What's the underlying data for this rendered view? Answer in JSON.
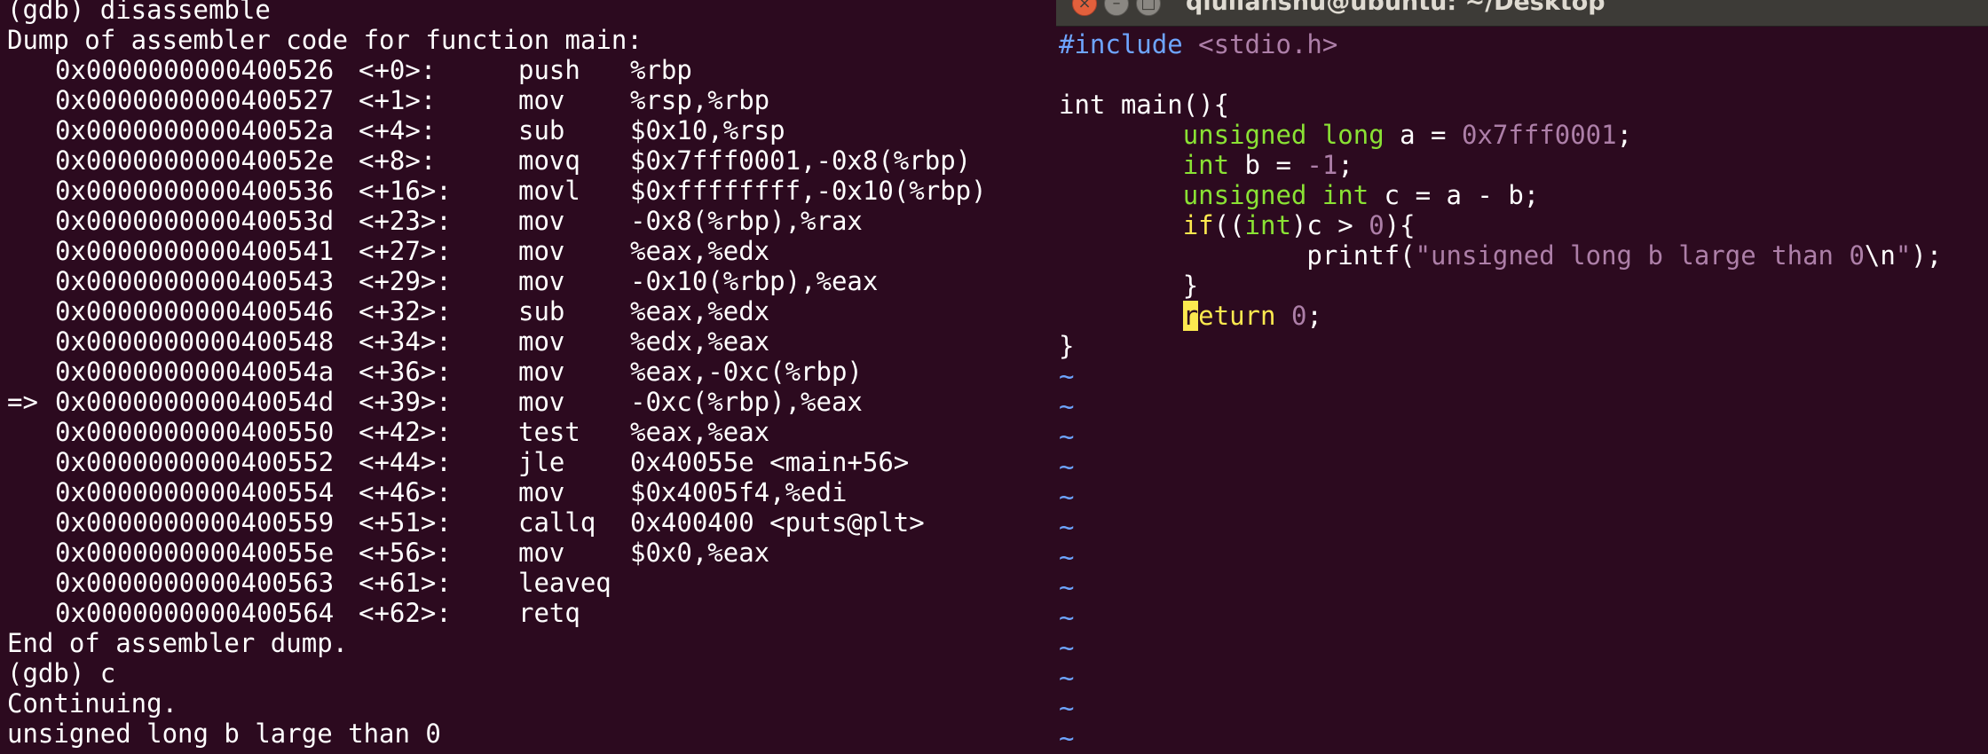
{
  "gdb": {
    "command": "(gdb) disassemble",
    "header": "Dump of assembler code for function main:",
    "rows": [
      {
        "marker": "",
        "addr": "0x0000000000400526",
        "off": "<+0>:",
        "mnemonic": "push",
        "operands": "%rbp"
      },
      {
        "marker": "",
        "addr": "0x0000000000400527",
        "off": "<+1>:",
        "mnemonic": "mov",
        "operands": "%rsp,%rbp"
      },
      {
        "marker": "",
        "addr": "0x000000000040052a",
        "off": "<+4>:",
        "mnemonic": "sub",
        "operands": "$0x10,%rsp"
      },
      {
        "marker": "",
        "addr": "0x000000000040052e",
        "off": "<+8>:",
        "mnemonic": "movq",
        "operands": "$0x7fff0001,-0x8(%rbp)"
      },
      {
        "marker": "",
        "addr": "0x0000000000400536",
        "off": "<+16>:",
        "mnemonic": "movl",
        "operands": "$0xffffffff,-0x10(%rbp)"
      },
      {
        "marker": "",
        "addr": "0x000000000040053d",
        "off": "<+23>:",
        "mnemonic": "mov",
        "operands": "-0x8(%rbp),%rax"
      },
      {
        "marker": "",
        "addr": "0x0000000000400541",
        "off": "<+27>:",
        "mnemonic": "mov",
        "operands": "%eax,%edx"
      },
      {
        "marker": "",
        "addr": "0x0000000000400543",
        "off": "<+29>:",
        "mnemonic": "mov",
        "operands": "-0x10(%rbp),%eax"
      },
      {
        "marker": "",
        "addr": "0x0000000000400546",
        "off": "<+32>:",
        "mnemonic": "sub",
        "operands": "%eax,%edx"
      },
      {
        "marker": "",
        "addr": "0x0000000000400548",
        "off": "<+34>:",
        "mnemonic": "mov",
        "operands": "%edx,%eax"
      },
      {
        "marker": "",
        "addr": "0x000000000040054a",
        "off": "<+36>:",
        "mnemonic": "mov",
        "operands": "%eax,-0xc(%rbp)"
      },
      {
        "marker": "=>",
        "addr": "0x000000000040054d",
        "off": "<+39>:",
        "mnemonic": "mov",
        "operands": "-0xc(%rbp),%eax"
      },
      {
        "marker": "",
        "addr": "0x0000000000400550",
        "off": "<+42>:",
        "mnemonic": "test",
        "operands": "%eax,%eax"
      },
      {
        "marker": "",
        "addr": "0x0000000000400552",
        "off": "<+44>:",
        "mnemonic": "jle",
        "operands": "0x40055e <main+56>"
      },
      {
        "marker": "",
        "addr": "0x0000000000400554",
        "off": "<+46>:",
        "mnemonic": "mov",
        "operands": "$0x4005f4,%edi"
      },
      {
        "marker": "",
        "addr": "0x0000000000400559",
        "off": "<+51>:",
        "mnemonic": "callq",
        "operands": "0x400400 <puts@plt>"
      },
      {
        "marker": "",
        "addr": "0x000000000040055e",
        "off": "<+56>:",
        "mnemonic": "mov",
        "operands": "$0x0,%eax"
      },
      {
        "marker": "",
        "addr": "0x0000000000400563",
        "off": "<+61>:",
        "mnemonic": "leaveq",
        "operands": ""
      },
      {
        "marker": "",
        "addr": "0x0000000000400564",
        "off": "<+62>:",
        "mnemonic": "retq",
        "operands": ""
      }
    ],
    "footer": "End of assembler dump.",
    "continue_cmd": "(gdb) c",
    "continuing": "Continuing.",
    "output": "unsigned long b large than 0"
  },
  "vim_window": {
    "title": "qiulianshu@ubuntu: ~/Desktop",
    "close_glyph": "×",
    "min_glyph": "–",
    "max_glyph": "□"
  },
  "source": {
    "include_kw": "#include",
    "include_hdr": "<stdio.h>",
    "main_sig": "int main(){",
    "l3_indent": "        ",
    "l3_type": "unsigned long",
    "l3_mid": " a = ",
    "l3_num": "0x7fff0001",
    "l3_end": ";",
    "l4_type": "int",
    "l4_mid": " b = ",
    "l4_num": "-1",
    "l4_end": ";",
    "l5_type": "unsigned int",
    "l5_rest": " c = a - b;",
    "l6_stmt": "if",
    "l6_a": "((",
    "l6_type": "int",
    "l6_b": ")c > ",
    "l6_num": "0",
    "l6_c": "){",
    "l7_indent": "                ",
    "l7_func": "printf(",
    "l7_str": "\"unsigned long b large than 0",
    "l7_esc": "\\n",
    "l7_quote": "\"",
    "l7_end": ");",
    "l8_brace": "}",
    "l9_cursor": "r",
    "l9_stmt": "eturn",
    "l9_sp": " ",
    "l9_num": "0",
    "l9_end": ";",
    "l10_brace": "}",
    "tilde": "~"
  },
  "colors": {
    "background": "#2c0a1f",
    "preproc": "#6ea5ff",
    "type": "#8ae234",
    "constant": "#ad7fa8",
    "statement": "#fce94f",
    "cursor": "#fce94f"
  }
}
